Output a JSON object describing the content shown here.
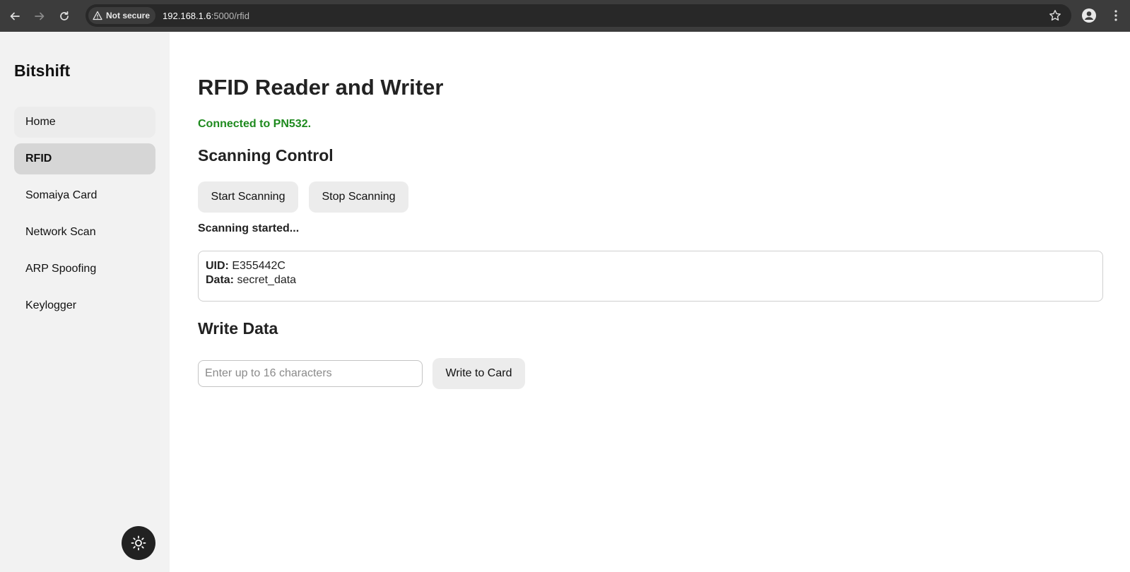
{
  "browser": {
    "security_label": "Not secure",
    "url_host": "192.168.1.6",
    "url_path": ":5000/rfid"
  },
  "sidebar": {
    "brand": "Bitshift",
    "items": [
      {
        "label": "Home"
      },
      {
        "label": "RFID"
      },
      {
        "label": "Somaiya Card"
      },
      {
        "label": "Network Scan"
      },
      {
        "label": "ARP Spoofing"
      },
      {
        "label": "Keylogger"
      }
    ],
    "active_item": "RFID",
    "theme_toggle_icon": "sun-icon"
  },
  "main": {
    "title": "RFID Reader and Writer",
    "connection_status": "Connected to PN532.",
    "status_color": "#1e8a1e",
    "scanning_control": {
      "title": "Scanning Control",
      "start_label": "Start Scanning",
      "stop_label": "Stop Scanning",
      "state": "Scanning started..."
    },
    "result": {
      "uid_key": "UID:",
      "uid_value": "E355442C",
      "data_key": "Data:",
      "data_value": "secret_data"
    },
    "write": {
      "title": "Write Data",
      "placeholder": "Enter up to 16 characters",
      "value": "",
      "button_label": "Write to Card"
    }
  }
}
